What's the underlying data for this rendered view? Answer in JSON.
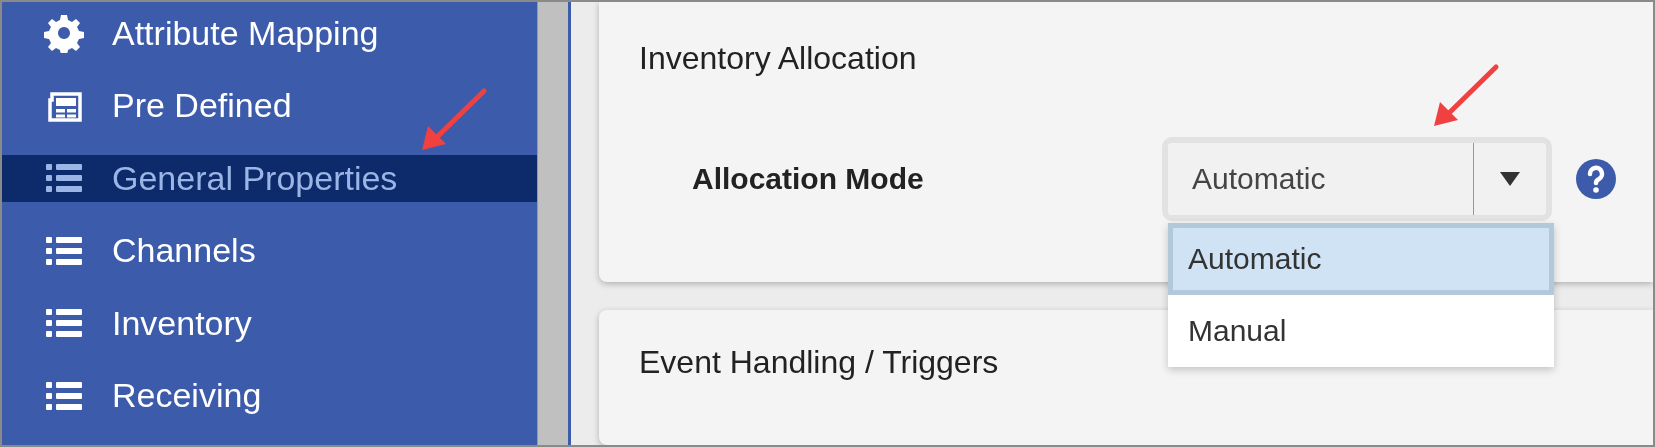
{
  "sidebar": {
    "items": [
      {
        "label": "Attribute Mapping",
        "kind": "gear",
        "selected": false
      },
      {
        "label": "Pre Defined",
        "kind": "panel",
        "selected": false
      },
      {
        "label": "General Properties",
        "kind": "list",
        "selected": true
      },
      {
        "label": "Channels",
        "kind": "list",
        "selected": false
      },
      {
        "label": "Inventory",
        "kind": "list",
        "selected": false
      },
      {
        "label": "Receiving",
        "kind": "list",
        "selected": false
      }
    ]
  },
  "sections": [
    {
      "title": "Inventory Allocation",
      "fields": [
        {
          "label": "Allocation Mode",
          "value": "Automatic",
          "expanded": true,
          "options": [
            {
              "label": "Automatic",
              "selected": true
            },
            {
              "label": "Manual",
              "selected": false
            }
          ]
        }
      ]
    },
    {
      "title": "Event Handling / Triggers"
    }
  ]
}
